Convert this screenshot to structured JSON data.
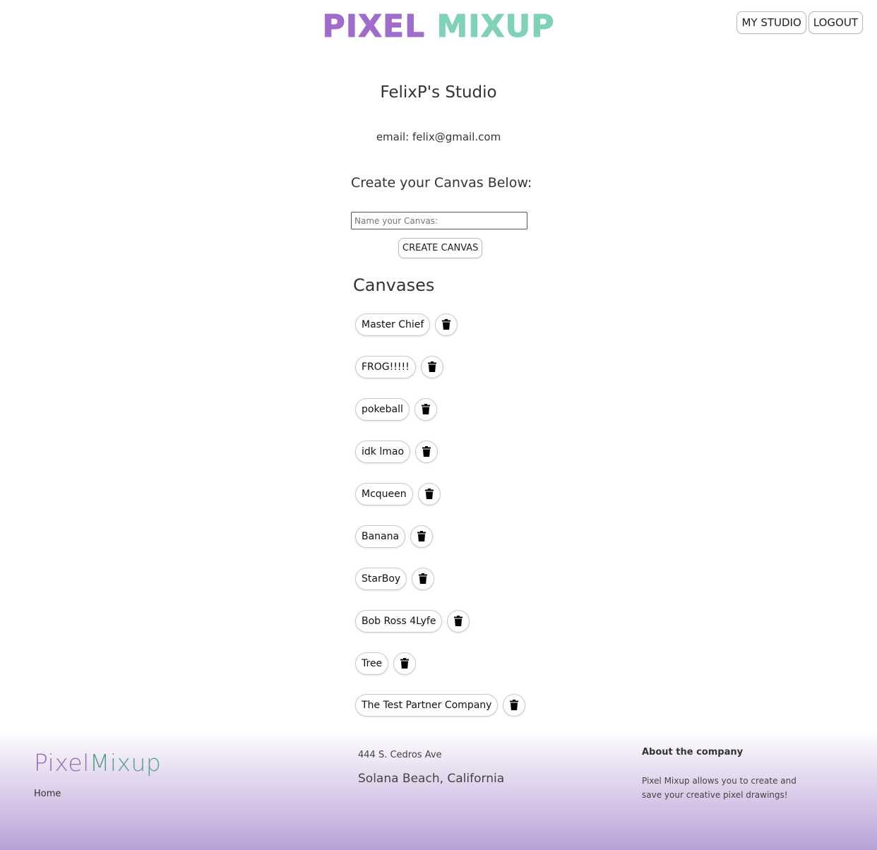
{
  "theme": {
    "purple": "#a06ccc",
    "teal": "#7fd3b4"
  },
  "header": {
    "logo_part1": "PIXEL",
    "logo_part2": "MIXUP",
    "my_studio_label": "MY STUDIO",
    "logout_label": "LOGOUT"
  },
  "studio": {
    "title": "FelixP's Studio",
    "email_line": "email: felix@gmail.com"
  },
  "create": {
    "heading": "Create your Canvas Below:",
    "input_placeholder": "Name your Canvas:",
    "input_value": "",
    "button_label": "CREATE CANVAS"
  },
  "canvases": {
    "heading": "Canvases",
    "delete_icon": "trash-icon",
    "items": [
      "Master Chief",
      "FROG!!!!!",
      "pokeball",
      "idk lmao",
      "Mcqueen",
      "Banana",
      "StarBoy",
      "Bob Ross 4Lyfe",
      "Tree",
      "The Test Partner Company"
    ]
  },
  "footer": {
    "brand_part1": "Pixel",
    "brand_part2": "Mixup",
    "home_link": "Home",
    "address_line1": "444 S. Cedros Ave",
    "address_line2": "Solana Beach, California",
    "about_title": "About the company",
    "about_text": "Pixel Mixup allows you to create and save your creative pixel drawings!"
  }
}
